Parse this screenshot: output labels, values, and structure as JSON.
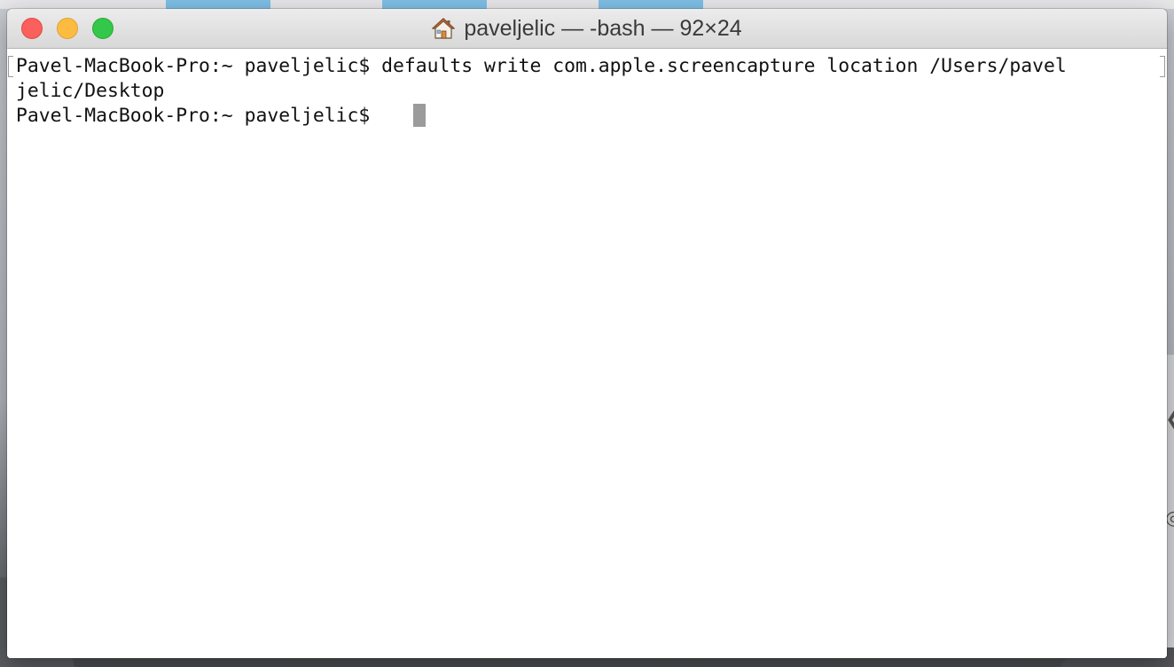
{
  "window": {
    "title": "paveljelic — -bash — 92×24",
    "title_icon": "home-icon",
    "buttons": [
      "close",
      "minimize",
      "zoom"
    ]
  },
  "terminal": {
    "lines": [
      "Pavel-MacBook-Pro:~ paveljelic$ defaults write com.apple.screencapture location /Users/pavel",
      "jelic/Desktop",
      "Pavel-MacBook-Pro:~ paveljelic$ "
    ]
  },
  "colors": {
    "close": "#fc605c",
    "minimize": "#fdbc40",
    "zoom": "#34c84a",
    "cursor": "#9b9b9b"
  }
}
